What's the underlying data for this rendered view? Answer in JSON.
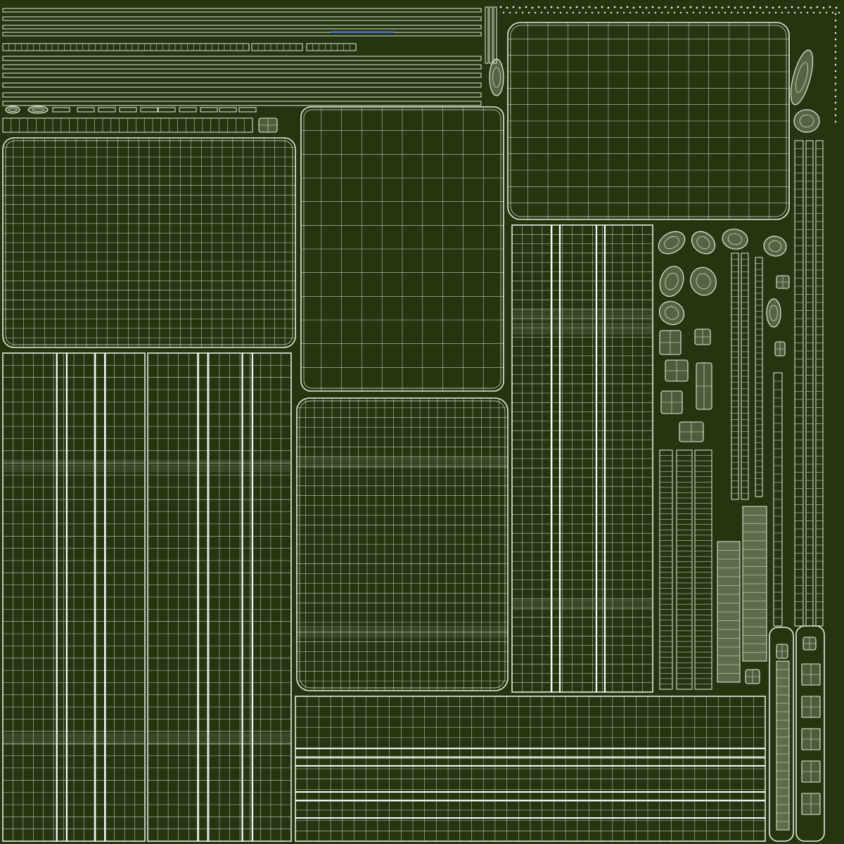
{
  "colors": {
    "background": "#243510",
    "wire": "#e8ede0",
    "wire_bright": "#ffffff",
    "wire_dense": "#c8d4b8",
    "accent_blue": "#4466cc"
  },
  "islands": {
    "top_rounded_panel": {
      "grid_cols": 14,
      "grid_rows": 12
    },
    "center_panel": {
      "grid_cols": 10,
      "grid_rows": 12
    },
    "left_panel": {
      "grid_cols": 28,
      "grid_rows": 22
    },
    "mid_panel": {
      "grid_cols": 24,
      "grid_rows": 30
    },
    "lower_left_a": {
      "grid_cols": 14,
      "grid_rows": 40
    },
    "lower_left_b": {
      "grid_cols": 14,
      "grid_rows": 40
    },
    "tall_strip": {
      "grid_cols": 14,
      "grid_rows": 50
    },
    "bottom_wide": {
      "grid_cols": 40,
      "grid_rows": 14
    }
  }
}
